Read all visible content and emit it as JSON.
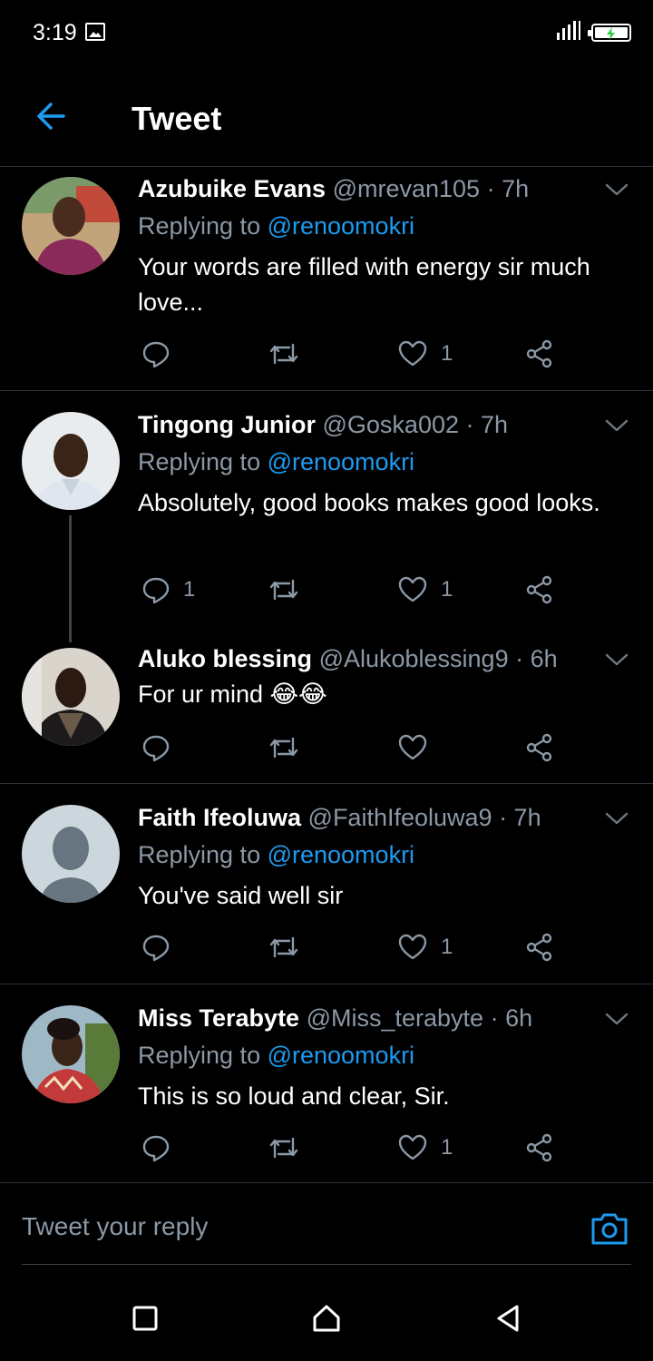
{
  "status_bar": {
    "time": "3:19"
  },
  "header": {
    "title": "Tweet"
  },
  "tweets": [
    {
      "name": "Azubuike Evans",
      "handle": "@mrevan105",
      "time": "· 7h",
      "replying_prefix": "Replying to ",
      "replying_to": "@renoomokri",
      "text": "Your words are filled with energy sir much love...",
      "replies": "",
      "retweets": "",
      "likes": "1"
    },
    {
      "name": "Tingong Junior",
      "handle": "@Goska002",
      "time": "· 7h",
      "replying_prefix": "Replying to ",
      "replying_to": "@renoomokri",
      "text": "Absolutely, good books makes good looks.",
      "replies": "1",
      "retweets": "",
      "likes": "1"
    },
    {
      "name": "Aluko blessing",
      "handle": "@Alukoblessing9",
      "time": "· 6h",
      "text": "For ur mind 😂😂",
      "replies": "",
      "retweets": "",
      "likes": ""
    },
    {
      "name": "Faith Ifeoluwa",
      "handle": "@FaithIfeoluwa9",
      "time": "· 7h",
      "replying_prefix": "Replying to ",
      "replying_to": "@renoomokri",
      "text": "You've said well sir",
      "replies": "",
      "retweets": "",
      "likes": "1"
    },
    {
      "name": "Miss Terabyte",
      "handle": "@Miss_terabyte",
      "time": "· 6h",
      "replying_prefix": "Replying to ",
      "replying_to": "@renoomokri",
      "text": "This is so loud and clear, Sir.",
      "replies": "",
      "retweets": "",
      "likes": "1"
    }
  ],
  "composer": {
    "placeholder": "Tweet your reply"
  },
  "icons": {
    "back": "arrow-left-icon",
    "more": "chevron-down-icon",
    "reply": "comment-bubble-icon",
    "retweet": "retweet-arrows-icon",
    "like": "heart-outline-icon",
    "share": "share-nodes-icon",
    "camera": "camera-icon",
    "nav": [
      "square-recents-icon",
      "home-outline-icon",
      "triangle-back-icon"
    ]
  },
  "colors": {
    "background": "#000000",
    "accent": "#1d9bf0",
    "secondary_text": "#8b98a5",
    "divider": "#2f3336"
  }
}
